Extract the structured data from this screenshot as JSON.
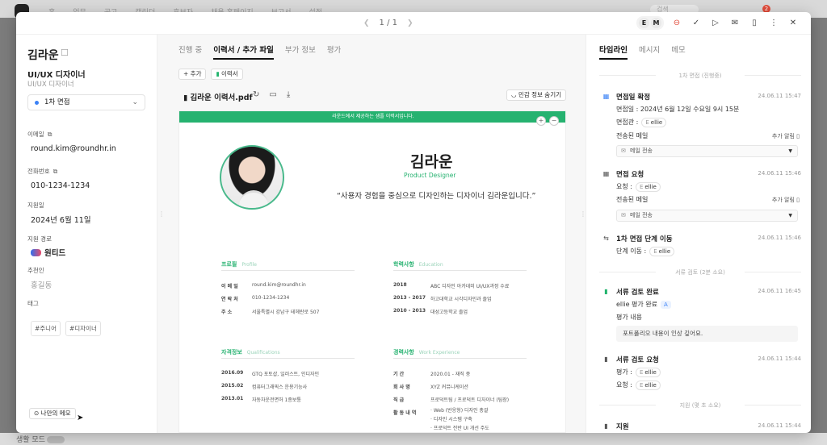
{
  "background": {
    "nav_items": [
      "홈",
      "업무",
      "공고",
      "캘린더",
      "후보자",
      "채용 홈페이지",
      "보고서",
      "설정"
    ],
    "search_placeholder": "검색",
    "notification_count": "2",
    "bottom_label": "생활 모드"
  },
  "modal": {
    "pager": "1 / 1",
    "avatars": [
      "E",
      "M"
    ]
  },
  "candidate": {
    "name": "김라운",
    "role": "UI/UX 디자이너",
    "role_sub": "UI/UX 디자이너",
    "stage": "1차 면접",
    "fields": {
      "email_label": "이메일",
      "email": "round.kim@roundhr.in",
      "phone_label": "전화번호",
      "phone": "010-1234-1234",
      "applied_label": "지원일",
      "applied": "2024년 6월 11일",
      "source_label": "지원 경로",
      "source": "원티드",
      "referrer_label": "추천인",
      "referrer": "홍길동",
      "tags_label": "태그"
    },
    "tags": [
      "#주니어",
      "#디자이너"
    ],
    "memo_button": "나만의 메모"
  },
  "center": {
    "tabs": [
      "진행 중",
      "이력서 / 추가 파일",
      "부가 정보",
      "평가"
    ],
    "add_button": "+ 추가",
    "resume_chip": "이력서",
    "file_name": "김라운 이력서.pdf",
    "privacy_button": "민감 정보 숨기기"
  },
  "resume": {
    "banner": "라운드에서 제공하는 샘플 이력서입니다.",
    "name": "김라운",
    "title": "Product Designer",
    "quote": "“사용자 경험을 중심으로 디자인하는 디자이너 김라운입니다.”",
    "profile": {
      "heading": "프로필",
      "heading_en": "Profile",
      "rows": [
        {
          "k": "이 메 일",
          "v": "round.kim@roundhr.in"
        },
        {
          "k": "연 락 처",
          "v": "010-1234-1234"
        },
        {
          "k": "주 소",
          "v": "서울특별시 강남구 테헤란로 507"
        }
      ]
    },
    "education": {
      "heading": "학력사항",
      "heading_en": "Education",
      "rows": [
        {
          "k": "2018",
          "v": "ABC 디자인 아카데미 UI/UX과정 수료"
        },
        {
          "k": "2013 - 2017",
          "v": "하고대학교 시각디자인과 졸업"
        },
        {
          "k": "2010 - 2013",
          "v": "대성고등학교 졸업"
        }
      ]
    },
    "certs": {
      "heading": "자격정보",
      "heading_en": "Qualifications",
      "rows": [
        {
          "k": "2016.09",
          "v": "GTQ 포토샵, 일러스트, 인디자인"
        },
        {
          "k": "2015.02",
          "v": "컴퓨터그래픽스 운용기능사"
        },
        {
          "k": "2013.01",
          "v": "자동차운전면허 1종보통"
        }
      ]
    },
    "career": {
      "heading": "경력사항",
      "heading_en": "Work Experience",
      "rows": [
        {
          "k": "기 간",
          "v": "2020.01 - 재직 중"
        },
        {
          "k": "회 사 명",
          "v": "XYZ 커뮤니케이션"
        },
        {
          "k": "직 급",
          "v": "프로덕트팀 / 프로덕트 디자이너 (팀장)"
        },
        {
          "k": "활 동 내 역",
          "v": ""
        }
      ],
      "bullets": [
        "· Web (반응형) 디자인 총괄",
        "· 디자인 시스템 구축",
        "· 프로덕트 전반 UI 개선 주도"
      ]
    }
  },
  "timeline": {
    "tabs": [
      "타임라인",
      "메시지",
      "메모"
    ],
    "dividers": [
      "1차 면접 (진행중)",
      "서류 검토 (2분 소요)",
      "지원 (몇 초 소요)"
    ],
    "events": [
      {
        "title": "면접일 확정",
        "time": "24.06.11 15:47",
        "line1": "면접일 : 2024년 6월 12일 수요일 9시 15분",
        "line2_label": "면접관 :",
        "person": "ellie",
        "mail_label": "전송된 메일",
        "side": "추가 알림",
        "mail_select": "메일 전송"
      },
      {
        "title": "면접 요청",
        "time": "24.06.11 15:46",
        "line1_label": "요청 :",
        "person": "ellie",
        "mail_label": "전송된 메일",
        "side": "추가 알림",
        "mail_select": "메일 전송"
      },
      {
        "title": "1차 면접 단계 이동",
        "time": "24.06.11 15:46",
        "line1_label": "단계 이동 :",
        "person": "ellie"
      },
      {
        "title": "서류 검토 완료",
        "time": "24.06.11 16:45",
        "line1": "ellie 평가 완료",
        "grade": "A",
        "line2": "평가 내용",
        "note": "포트폴리오 내용이 인상 깊어요."
      },
      {
        "title": "서류 검토 요청",
        "time": "24.06.11 15:44",
        "line1_label": "평가 :",
        "person": "ellie",
        "line2_label": "요청 :",
        "person2": "ellie"
      },
      {
        "title": "지원",
        "time": "24.06.11 15:44"
      }
    ]
  }
}
